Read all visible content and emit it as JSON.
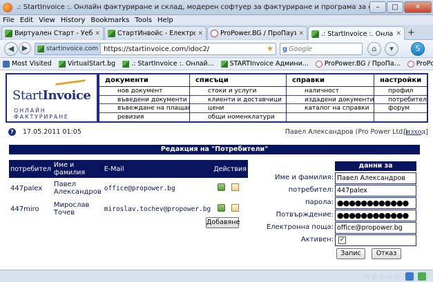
{
  "window": {
    "title": ".: StartInvoice :. Онлайн фактуриране и склад, модерен софтуер за фактуриране и програма за складово стопанство - Mozilla Firefox",
    "minimize": "–",
    "maximize": "□",
    "close": "✕"
  },
  "menu": [
    "File",
    "Edit",
    "View",
    "History",
    "Bookmarks",
    "Tools",
    "Help"
  ],
  "tabs": [
    {
      "label": "Виртуален Старт - Уеб сист...",
      "close": "✕"
    },
    {
      "label": "СтартИнвойс - Електронни...",
      "close": "✕"
    },
    {
      "label": "ProPower.BG / ПроПауър.Б...",
      "close": "✕"
    },
    {
      "label": ".: StartInvoice :. Онлайн фак...",
      "close": "✕"
    }
  ],
  "new_tab": "+",
  "nav": {
    "site_badge": "startinvoice.com",
    "url": "https://startinvoice.com/idoc2/",
    "search_placeholder": "Google",
    "search_brand": "g"
  },
  "bookmarks": [
    "Most Visited",
    "VirtualStart.bg",
    ".: StartInvoice :. Онлай...",
    "STARTInvoice Админи...",
    "ProPower.BG / ПроПа...",
    "ProPower - Login"
  ],
  "logo": {
    "brand_a": "Start",
    "brand_b": "Invoice",
    "tagline": "ОНЛАЙН ФАКТУРИРАНЕ"
  },
  "app_menu": [
    {
      "head": "документи",
      "items": [
        "нов документ",
        "въведени документи",
        "въвеждане на плащания",
        "ревизия"
      ]
    },
    {
      "head": "списъци",
      "items": [
        "стоки и услуги",
        "клиенти и доставчици",
        "цени",
        "общи номенклатури"
      ]
    },
    {
      "head": "справки",
      "items": [
        "наличност",
        "издадени документи",
        "каталог на справки",
        ""
      ]
    },
    {
      "head": "настройки",
      "items": [
        "профил",
        "потребители",
        "форум",
        ""
      ]
    }
  ],
  "info": {
    "help": "?",
    "datetime": "17.05.2011 01:05",
    "user": "Павел Александров (Pro Power Ltd.)",
    "logout": "[изход]"
  },
  "section_title": "Редакция на \"Потребители\"",
  "users_table": {
    "headers": [
      "потребител",
      "Име и фамилия",
      "E-Mail",
      "Действия"
    ],
    "rows": [
      {
        "username": "447palex",
        "name": "Павел Александров",
        "email": "office@propower.bg"
      },
      {
        "username": "447miro",
        "name": "Мирослав Точев",
        "email": "miroslav.tochev@propower.bg"
      }
    ],
    "add_button": "Добавяне"
  },
  "form": {
    "title": "данни за потребителя",
    "fields": [
      {
        "label": "Име и фамилия:",
        "value": "Павел Александров"
      },
      {
        "label": "потребител:",
        "value": "447palex"
      },
      {
        "label": "парола:",
        "value": "●●●●●●●●●●●●"
      },
      {
        "label": "Потвърждение:",
        "value": "●●●●●●●●●●●●"
      },
      {
        "label": "Електронна поща:",
        "value": "office@propower.bg"
      },
      {
        "label": "Активен:",
        "value": "✓"
      }
    ],
    "save_button": "Запис",
    "cancel_button": "Отказ"
  },
  "status": {
    "stars": "☆☆☆☆☆"
  }
}
